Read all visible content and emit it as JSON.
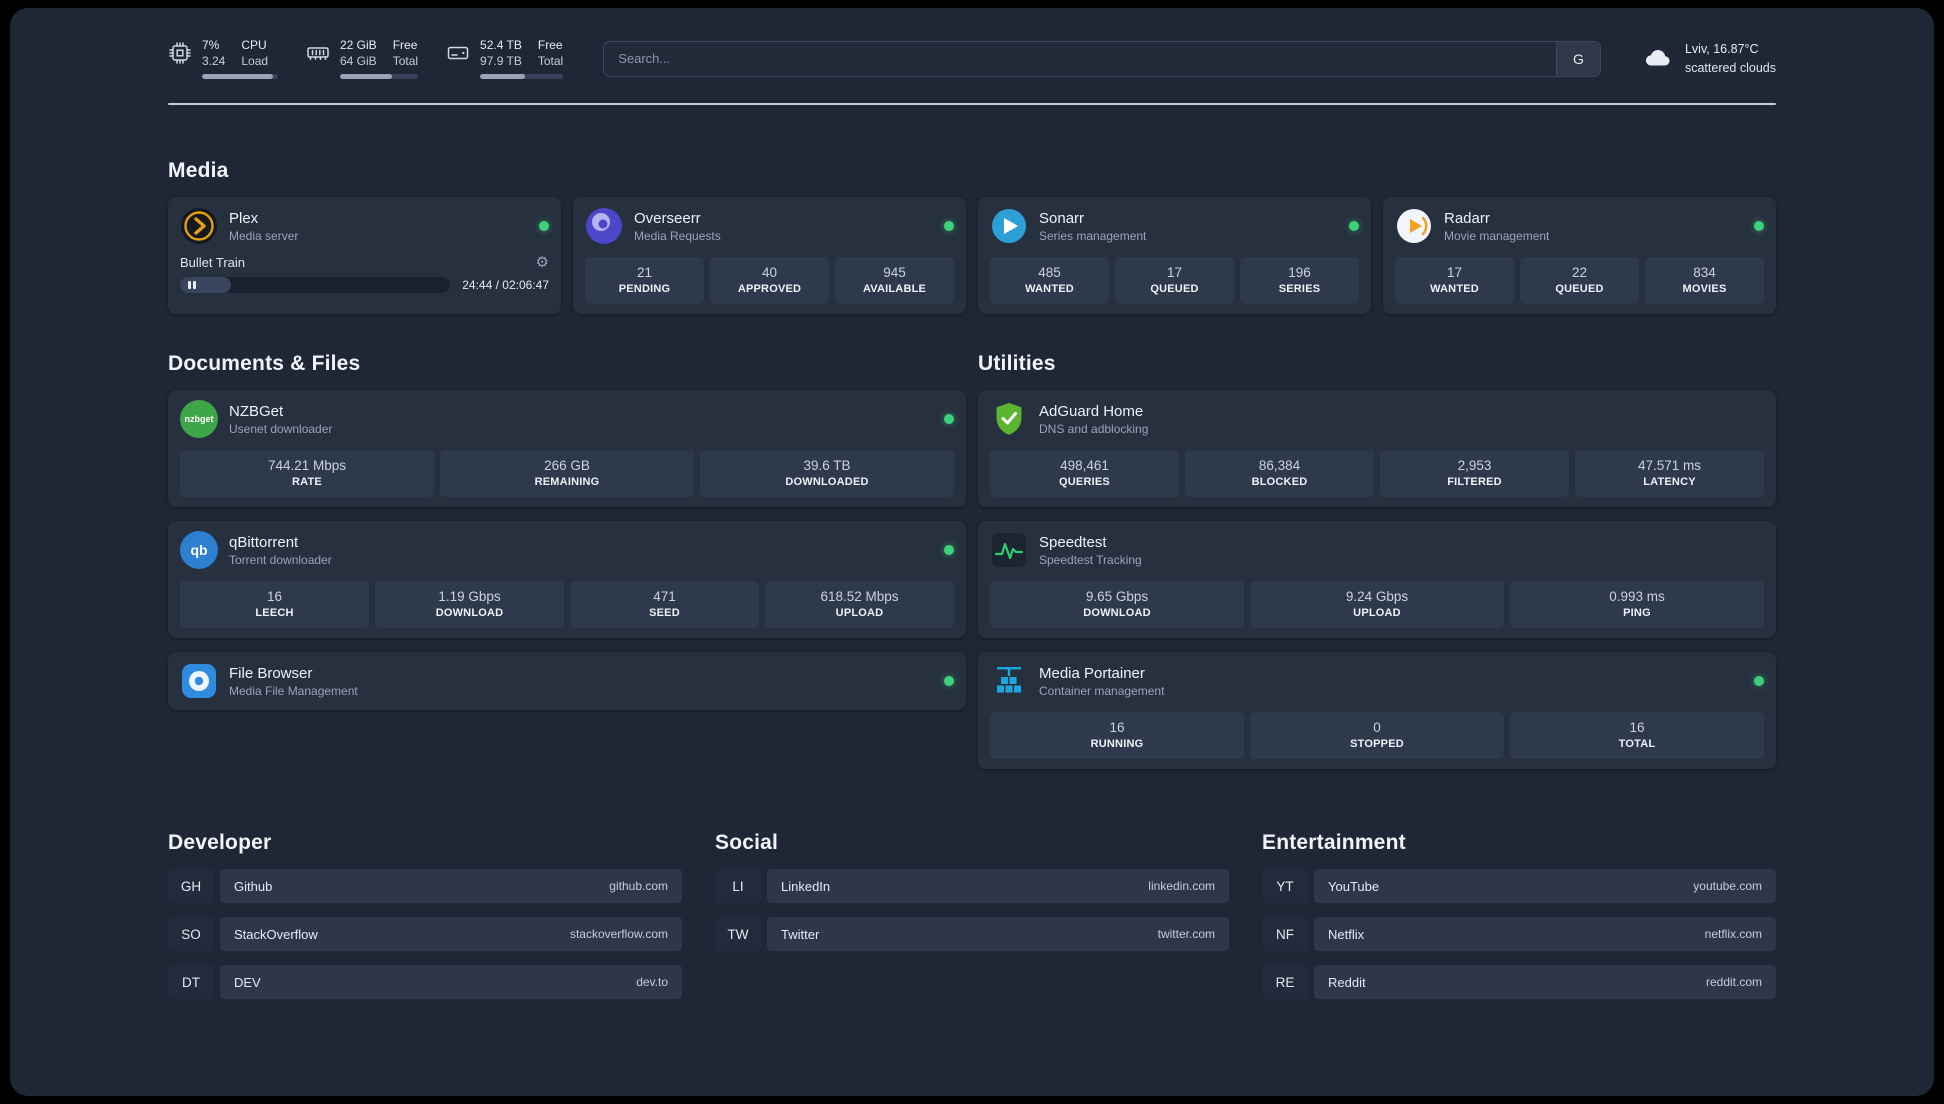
{
  "colors": {
    "status_online": "#3ed17b",
    "accent_amber": "#e5a00d",
    "page_bg": "#1f2636",
    "card_bg": "#27303f"
  },
  "topbar": {
    "cpu": {
      "percent": "7%",
      "load": "3.24",
      "label_top": "CPU",
      "label_bottom": "Load",
      "bar_percent": 93
    },
    "memory": {
      "value_top": "22 GiB",
      "value_bottom": "64 GiB",
      "label_top": "Free",
      "label_bottom": "Total",
      "bar_percent": 66
    },
    "disk": {
      "value_top": "52.4 TB",
      "value_bottom": "97.9 TB",
      "label_top": "Free",
      "label_bottom": "Total",
      "bar_percent": 54
    },
    "search": {
      "placeholder": "Search...",
      "button_label": "G"
    },
    "weather": {
      "location": "Lviv, 16.87°C",
      "condition": "scattered clouds"
    }
  },
  "sections": {
    "media": {
      "title": "Media"
    },
    "documents": {
      "title": "Documents & Files"
    },
    "utilities": {
      "title": "Utilities"
    }
  },
  "services": {
    "plex": {
      "name": "Plex",
      "desc": "Media server",
      "player": {
        "title": "Bullet Train",
        "time": "24:44 / 02:06:47",
        "progress_percent": 19
      }
    },
    "overseerr": {
      "name": "Overseerr",
      "desc": "Media Requests",
      "stats": [
        {
          "value": "21",
          "label": "PENDING"
        },
        {
          "value": "40",
          "label": "APPROVED"
        },
        {
          "value": "945",
          "label": "AVAILABLE"
        }
      ]
    },
    "sonarr": {
      "name": "Sonarr",
      "desc": "Series management",
      "stats": [
        {
          "value": "485",
          "label": "WANTED"
        },
        {
          "value": "17",
          "label": "QUEUED"
        },
        {
          "value": "196",
          "label": "SERIES"
        }
      ]
    },
    "radarr": {
      "name": "Radarr",
      "desc": "Movie management",
      "stats": [
        {
          "value": "17",
          "label": "WANTED"
        },
        {
          "value": "22",
          "label": "QUEUED"
        },
        {
          "value": "834",
          "label": "MOVIES"
        }
      ]
    },
    "nzbget": {
      "name": "NZBGet",
      "desc": "Usenet downloader",
      "icon_text": "nzbget",
      "stats": [
        {
          "value": "744.21 Mbps",
          "label": "RATE"
        },
        {
          "value": "266 GB",
          "label": "REMAINING"
        },
        {
          "value": "39.6 TB",
          "label": "DOWNLOADED"
        }
      ]
    },
    "qbittorrent": {
      "name": "qBittorrent",
      "desc": "Torrent downloader",
      "icon_text": "qb",
      "stats": [
        {
          "value": "16",
          "label": "LEECH"
        },
        {
          "value": "1.19 Gbps",
          "label": "DOWNLOAD"
        },
        {
          "value": "471",
          "label": "SEED"
        },
        {
          "value": "618.52 Mbps",
          "label": "UPLOAD"
        }
      ]
    },
    "filebrowser": {
      "name": "File Browser",
      "desc": "Media File Management"
    },
    "adguard": {
      "name": "AdGuard Home",
      "desc": "DNS and adblocking",
      "stats": [
        {
          "value": "498,461",
          "label": "QUERIES"
        },
        {
          "value": "86,384",
          "label": "BLOCKED"
        },
        {
          "value": "2,953",
          "label": "FILTERED"
        },
        {
          "value": "47.571 ms",
          "label": "LATENCY"
        }
      ]
    },
    "speedtest": {
      "name": "Speedtest",
      "desc": "Speedtest Tracking",
      "stats": [
        {
          "value": "9.65 Gbps",
          "label": "DOWNLOAD"
        },
        {
          "value": "9.24 Gbps",
          "label": "UPLOAD"
        },
        {
          "value": "0.993 ms",
          "label": "PING"
        }
      ]
    },
    "portainer": {
      "name": "Media Portainer",
      "desc": "Container management",
      "stats": [
        {
          "value": "16",
          "label": "RUNNING"
        },
        {
          "value": "0",
          "label": "STOPPED"
        },
        {
          "value": "16",
          "label": "TOTAL"
        }
      ]
    }
  },
  "bookmarks": {
    "developer": {
      "title": "Developer",
      "items": [
        {
          "abbr": "GH",
          "name": "Github",
          "domain": "github.com"
        },
        {
          "abbr": "SO",
          "name": "StackOverflow",
          "domain": "stackoverflow.com"
        },
        {
          "abbr": "DT",
          "name": "DEV",
          "domain": "dev.to"
        }
      ]
    },
    "social": {
      "title": "Social",
      "items": [
        {
          "abbr": "LI",
          "name": "LinkedIn",
          "domain": "linkedin.com"
        },
        {
          "abbr": "TW",
          "name": "Twitter",
          "domain": "twitter.com"
        }
      ]
    },
    "entertainment": {
      "title": "Entertainment",
      "items": [
        {
          "abbr": "YT",
          "name": "YouTube",
          "domain": "youtube.com"
        },
        {
          "abbr": "NF",
          "name": "Netflix",
          "domain": "netflix.com"
        },
        {
          "abbr": "RE",
          "name": "Reddit",
          "domain": "reddit.com"
        }
      ]
    }
  }
}
